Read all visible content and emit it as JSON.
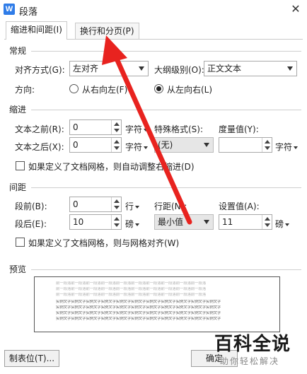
{
  "window": {
    "title": "段落",
    "app_icon": "W",
    "close_glyph": "✕"
  },
  "tabs": [
    {
      "label": "缩进和间距(I)"
    },
    {
      "label": "换行和分页(P)"
    }
  ],
  "general": {
    "title": "常规",
    "align_label": "对齐方式(G):",
    "align_value": "左对齐",
    "outline_label": "大纲级别(O):",
    "outline_value": "正文文本",
    "direction_label": "方向:",
    "rtl_label": "从右向左(F)",
    "ltr_label": "从左向右(L)"
  },
  "indent": {
    "title": "缩进",
    "before_label": "文本之前(R):",
    "before_value": "0",
    "before_unit": "字符",
    "after_label": "文本之后(X):",
    "after_value": "0",
    "after_unit": "字符",
    "special_label": "特殊格式(S):",
    "special_value": "(无)",
    "measure_label": "度量值(Y):",
    "measure_value": "",
    "measure_unit": "字符",
    "grid_check_label": "如果定义了文档网格，则自动调整右缩进(D)"
  },
  "spacing": {
    "title": "间距",
    "before_label": "段前(B):",
    "before_value": "0",
    "before_unit": "行",
    "after_label": "段后(E):",
    "after_value": "10",
    "after_unit": "磅",
    "line_label": "行距(N):",
    "line_value": "最小值",
    "setting_label": "设置值(A):",
    "setting_value": "11",
    "setting_unit": "磅",
    "grid_check_label": "如果定义了文档网格，则与网格对齐(W)"
  },
  "preview": {
    "title": "预览",
    "prev_line": "前一段落前一段落前一段落前一段落前一段落前一段落前一段落前一段落前一段落前一段落",
    "sample_line": "实例文字实例文字实例文字实例文字实例文字实例文字实例文字实例文字实例文字实例文字实例文字"
  },
  "buttons": {
    "tabs_button": "制表位(T)...",
    "ok_button": "确定"
  },
  "watermark": {
    "big": "百科全说",
    "small": "助你轻松解决"
  },
  "colors": {
    "accent": "#2f7ce8",
    "arrow": "#e8231f",
    "watermark_green": "#21b06a"
  }
}
